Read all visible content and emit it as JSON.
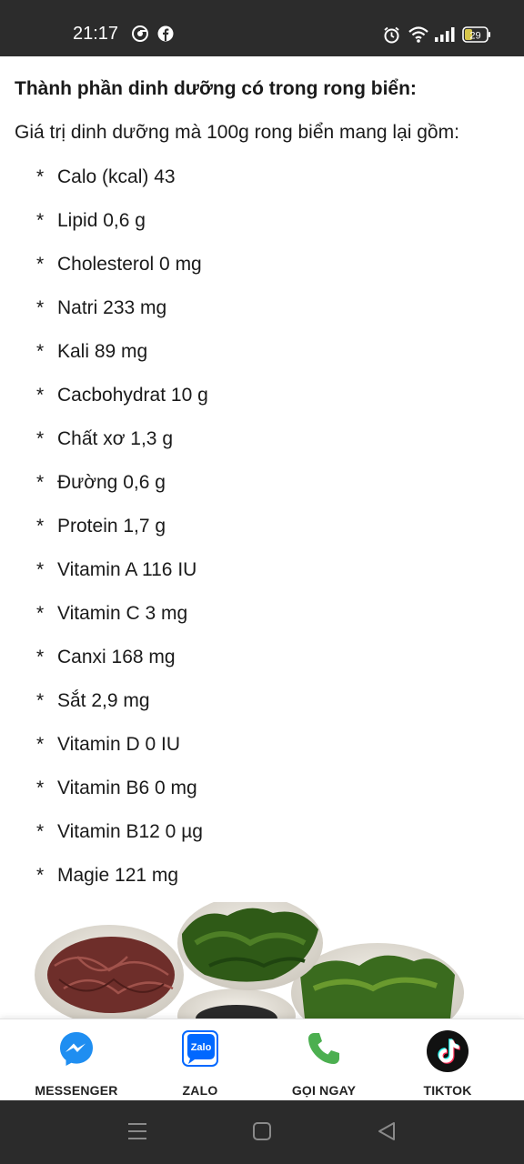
{
  "status_bar": {
    "time": "21:17",
    "battery": "29",
    "icons": [
      "chrome-icon",
      "facebook-icon",
      "alarm-icon",
      "wifi-icon",
      "signal-icon",
      "battery-icon"
    ]
  },
  "article": {
    "heading": "Thành phần dinh dưỡng có trong rong biển:",
    "intro": "Giá trị dinh dưỡng mà 100g rong biển mang lại gồm:",
    "bullet": "*",
    "nutrients": [
      "Calo (kcal) 43",
      "Lipid 0,6 g",
      "Cholesterol 0 mg",
      "Natri 233 mg",
      "Kali 89 mg",
      "Cacbohydrat 10 g",
      "Chất xơ 1,3 g",
      "Đường 0,6 g",
      "Protein 1,7 g",
      "Vitamin A 116 IU",
      "Vitamin C 3 mg",
      "Canxi 168 mg",
      "Sắt 2,9 mg",
      "Vitamin D 0 IU",
      "Vitamin B6 0 mg",
      "Vitamin B12 0 µg",
      "Magie 121 mg"
    ]
  },
  "action_bar": {
    "messenger_label": "MESSENGER",
    "zalo_label": "ZALO",
    "zalo_logo_text": "Zalo",
    "call_label": "GỌI NGAY",
    "tiktok_label": "TIKTOK"
  },
  "colors": {
    "messenger_blue": "#1f8ef1",
    "zalo_blue": "#0068ff",
    "call_green": "#4caf50",
    "status_bar_bg": "#2c2c2c"
  }
}
